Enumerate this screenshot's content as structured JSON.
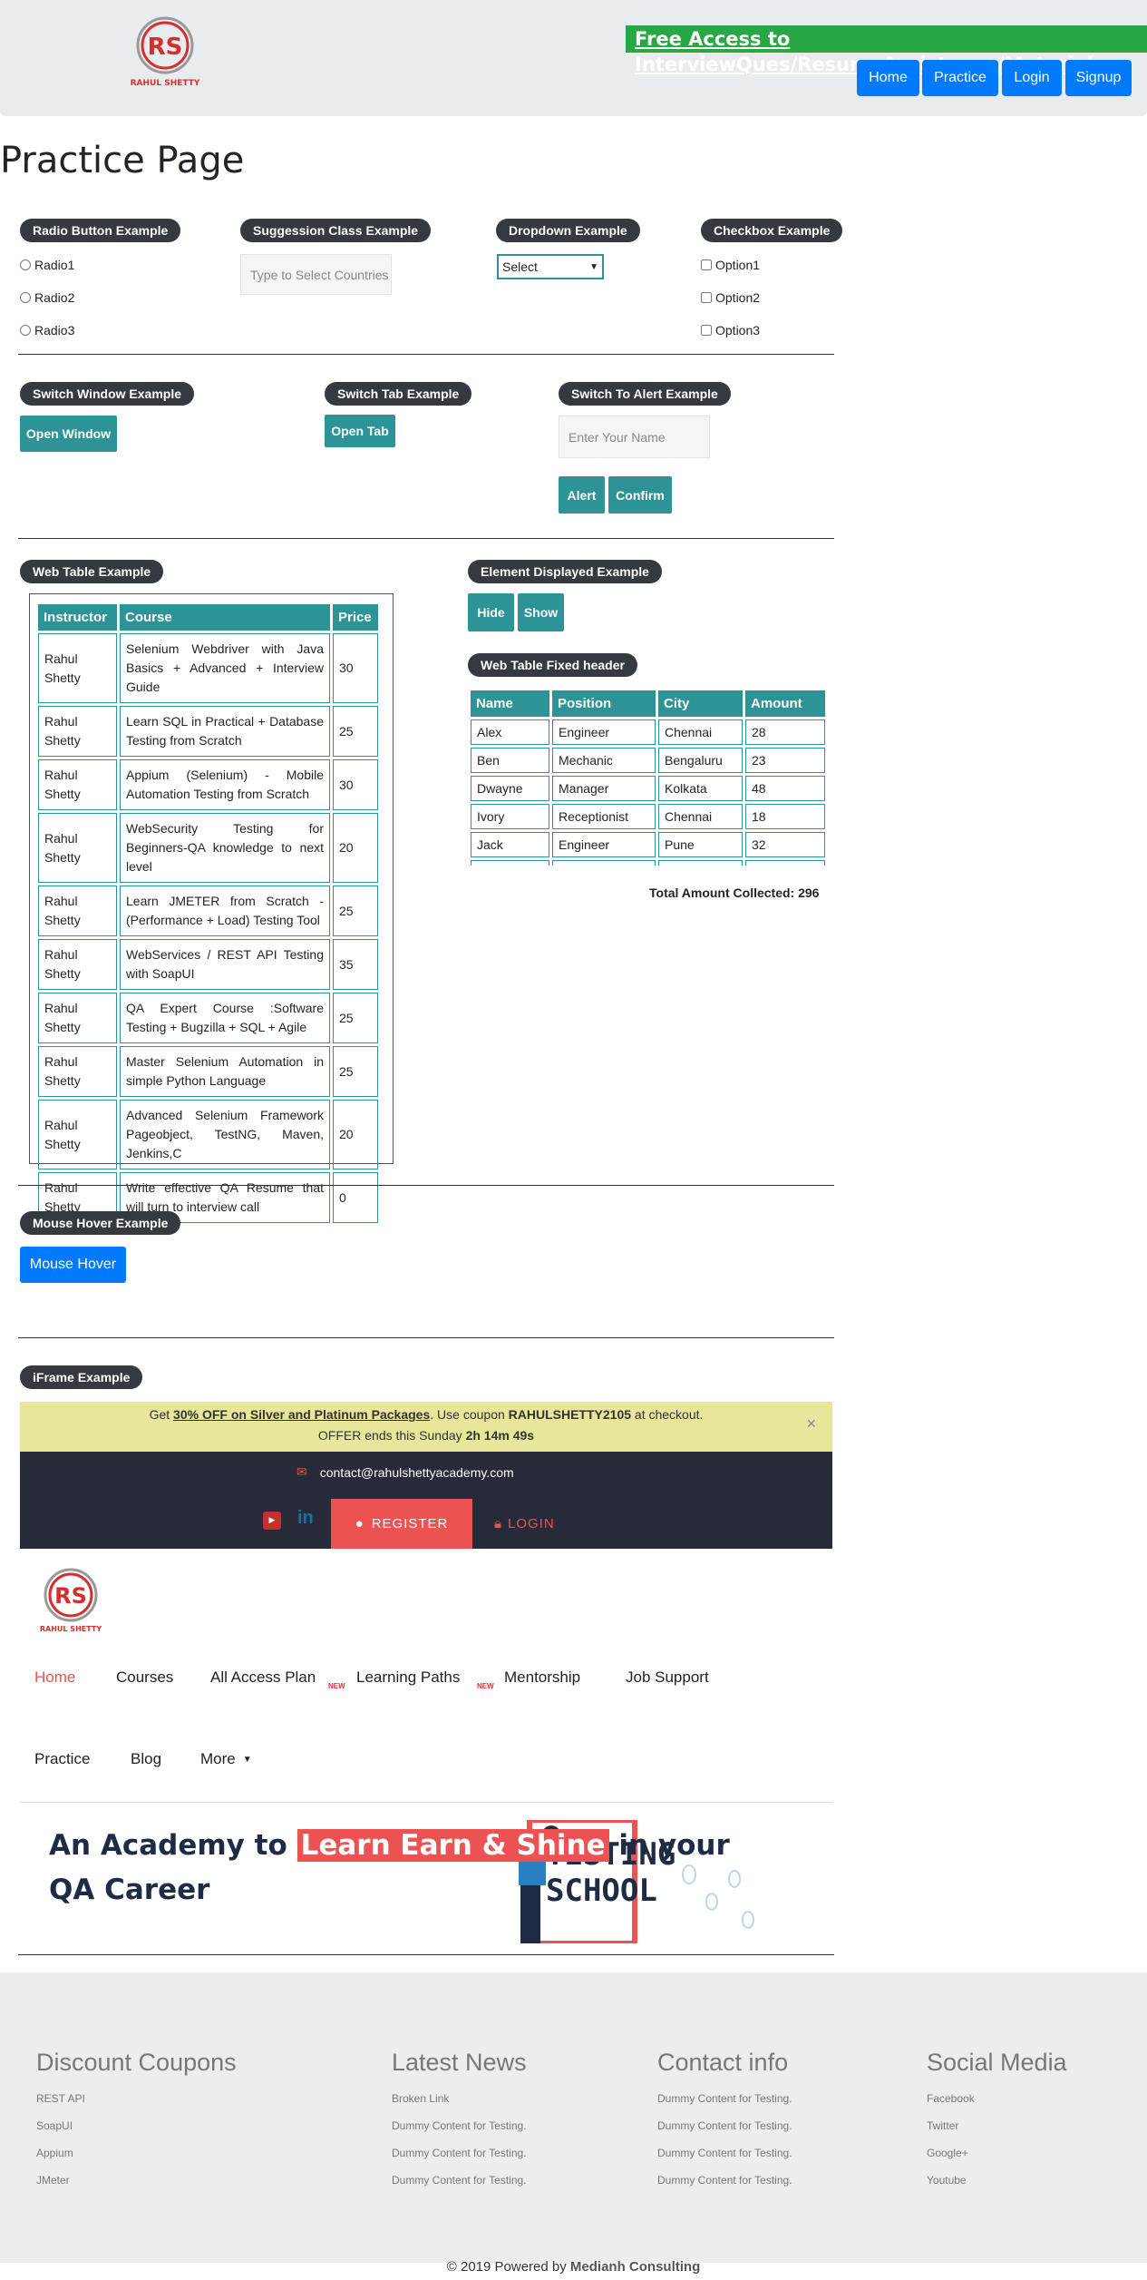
{
  "header": {
    "logo_text": "RAHUL SHETTY",
    "free_access": "Free Access to InterviewQues/ResumeAssistance/Material",
    "nav": [
      "Home",
      "Practice",
      "Login",
      "Signup"
    ]
  },
  "page_title": "Practice Page",
  "radio": {
    "legend": "Radio Button Example",
    "options": [
      "Radio1",
      "Radio2",
      "Radio3"
    ]
  },
  "suggestion": {
    "legend": "Suggession Class Example",
    "placeholder": "Type to Select Countries"
  },
  "dropdown": {
    "legend": "Dropdown Example",
    "selected": "Select"
  },
  "checkbox": {
    "legend": "Checkbox Example",
    "options": [
      "Option1",
      "Option2",
      "Option3"
    ]
  },
  "switch_window": {
    "legend": "Switch Window Example",
    "button": "Open Window"
  },
  "switch_tab": {
    "legend": "Switch Tab Example",
    "button": "Open Tab"
  },
  "alert": {
    "legend": "Switch To Alert Example",
    "placeholder": "Enter Your Name",
    "alert_button": "Alert",
    "confirm_button": "Confirm"
  },
  "web_table": {
    "legend": "Web Table Example",
    "headers": [
      "Instructor",
      "Course",
      "Price"
    ],
    "rows": [
      [
        "Rahul Shetty",
        "Selenium Webdriver with Java Basics + Advanced + Interview Guide",
        "30"
      ],
      [
        "Rahul Shetty",
        "Learn SQL in Practical + Database Testing from Scratch",
        "25"
      ],
      [
        "Rahul Shetty",
        "Appium (Selenium) - Mobile Automation Testing from Scratch",
        "30"
      ],
      [
        "Rahul Shetty",
        "WebSecurity Testing for Beginners-QA knowledge to next level",
        "20"
      ],
      [
        "Rahul Shetty",
        "Learn JMETER from Scratch - (Performance + Load) Testing Tool",
        "25"
      ],
      [
        "Rahul Shetty",
        "WebServices / REST API Testing with SoapUI",
        "35"
      ],
      [
        "Rahul Shetty",
        "QA Expert Course :Software Testing + Bugzilla + SQL + Agile",
        "25"
      ],
      [
        "Rahul Shetty",
        "Master Selenium Automation in simple Python Language",
        "25"
      ],
      [
        "Rahul Shetty",
        "Advanced Selenium Framework Pageobject, TestNG, Maven, Jenkins,C",
        "20"
      ],
      [
        "Rahul Shetty",
        "Write effective QA Resume that will turn to interview call",
        "0"
      ]
    ]
  },
  "element_displayed": {
    "legend": "Element Displayed Example",
    "hide_button": "Hide",
    "show_button": "Show"
  },
  "fixed_table": {
    "legend": "Web Table Fixed header",
    "headers": [
      "Name",
      "Position",
      "City",
      "Amount"
    ],
    "rows": [
      [
        "Alex",
        "Engineer",
        "Chennai",
        "28"
      ],
      [
        "Ben",
        "Mechanic",
        "Bengaluru",
        "23"
      ],
      [
        "Dwayne",
        "Manager",
        "Kolkata",
        "48"
      ],
      [
        "Ivory",
        "Receptionist",
        "Chennai",
        "18"
      ],
      [
        "Jack",
        "Engineer",
        "Pune",
        "32"
      ],
      [
        "",
        "",
        "",
        ""
      ]
    ],
    "total_label": "Total Amount Collected: 296"
  },
  "mouse_hover": {
    "legend": "Mouse Hover Example",
    "button": "Mouse Hover"
  },
  "iframe": {
    "legend": "iFrame Example",
    "promo_prefix": "Get ",
    "promo_offer": "30% OFF on Silver and Platinum Packages",
    "promo_mid": ". Use coupon ",
    "promo_code": "RAHULSHETTY2105",
    "promo_suffix": " at checkout.",
    "promo_ends": "OFFER ends this Sunday ",
    "promo_timer": "2h 14m 49s",
    "close": "×",
    "email": "contact@rahulshettyacademy.com",
    "register": "REGISTER",
    "login": "LOGIN",
    "menu_row1": [
      "Home",
      "Courses",
      "All Access Plan",
      "Learning Paths",
      "Mentorship",
      "Job Support"
    ],
    "new_tag": "NEW",
    "menu_row2": [
      "Practice",
      "Blog",
      "More"
    ],
    "hero_pre": "An Academy to ",
    "hero_hl": "Learn Earn & Shine",
    "hero_post": " in your QA Career",
    "hero_image_text": "TESTING SCHOOL"
  },
  "footer": {
    "columns": [
      {
        "title": "Discount Coupons",
        "links": [
          "REST API",
          "SoapUI",
          "Appium",
          "JMeter"
        ]
      },
      {
        "title": "Latest News",
        "links": [
          "Broken Link",
          "Dummy Content for Testing.",
          "Dummy Content for Testing.",
          "Dummy Content for Testing."
        ]
      },
      {
        "title": "Contact info",
        "links": [
          "Dummy Content for Testing.",
          "Dummy Content for Testing.",
          "Dummy Content for Testing.",
          "Dummy Content for Testing."
        ]
      },
      {
        "title": "Social Media",
        "links": [
          "Facebook",
          "Twitter",
          "Google+",
          "Youtube"
        ]
      }
    ],
    "copyright_prefix": "© 2019 Powered by ",
    "copyright_brand": "Medianh Consulting"
  },
  "colors": {
    "teal": "#2d9396",
    "blue": "#007bff",
    "green": "#28a745",
    "dark": "#343a40",
    "red": "#ec5252"
  }
}
